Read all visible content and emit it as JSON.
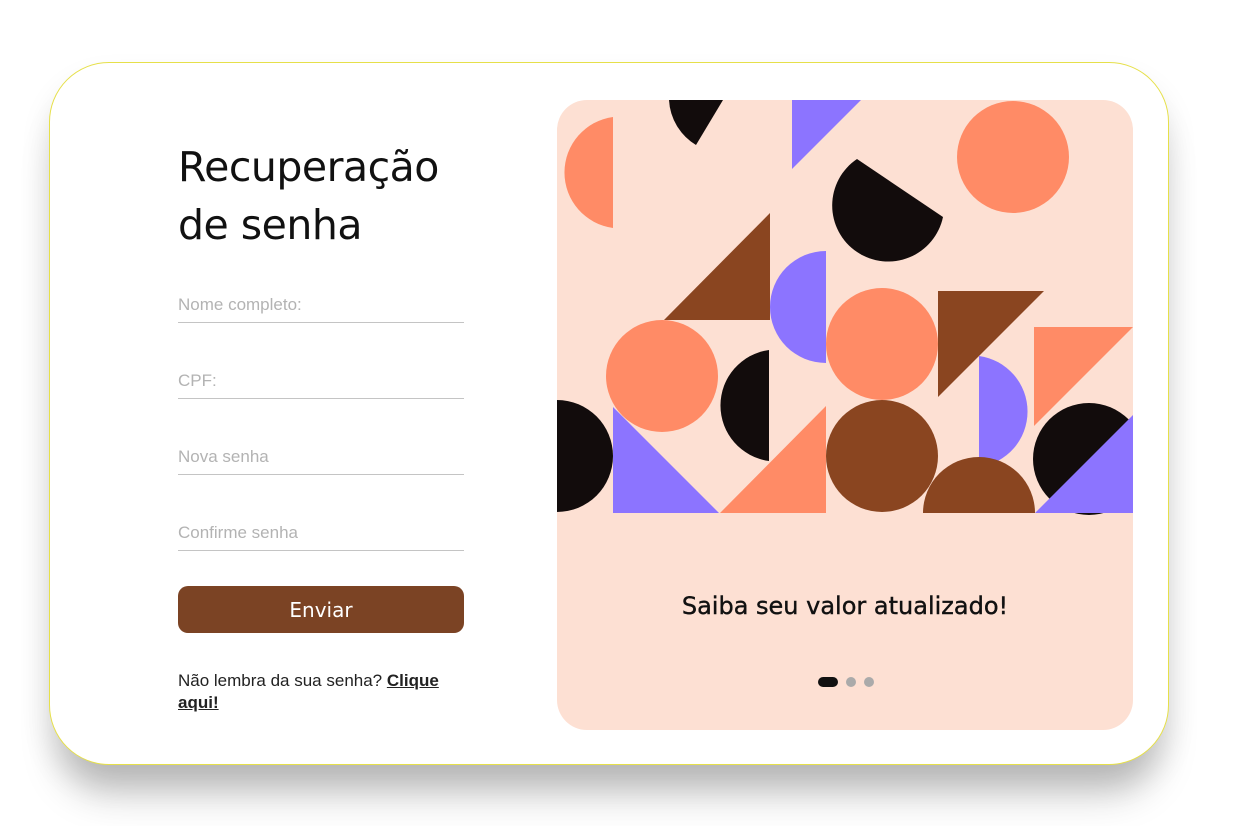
{
  "form": {
    "title_line1": "Recuperação",
    "title_line2": "de senha",
    "fields": [
      {
        "placeholder": "Nome completo:",
        "value": ""
      },
      {
        "placeholder": "CPF:",
        "value": ""
      },
      {
        "placeholder": "Nova senha",
        "value": ""
      },
      {
        "placeholder": "Confirme senha",
        "value": ""
      }
    ],
    "submit_label": "Enviar",
    "help_text": "Não lembra da sua senha? ",
    "help_link": "Clique aqui!"
  },
  "carousel": {
    "caption": "Saiba seu valor atualizado!",
    "slides": 3,
    "active_slide": 1
  },
  "colors": {
    "border": "#e6e04a",
    "button": "#7b4324",
    "panel_bg": "#fde0d3",
    "orange": "#ff8b66",
    "brown": "#8a4520",
    "purple": "#8c74ff",
    "black": "#120c0c"
  }
}
